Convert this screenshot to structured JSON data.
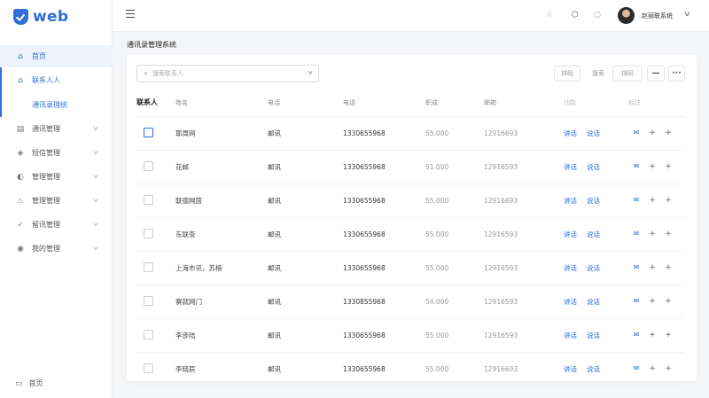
{
  "brand": {
    "name": "web"
  },
  "colors": {
    "accent": "#2f6fd6"
  },
  "sidebar": {
    "items": [
      {
        "label": "首页",
        "icon": "home-icon",
        "state": "highlight"
      },
      {
        "label": "联系人人",
        "icon": "home-icon",
        "state": "active"
      },
      {
        "label": "通讯录理统",
        "icon": "",
        "state": "sub"
      },
      {
        "label": "通讯管理",
        "icon": "document-icon",
        "state": "collapsed"
      },
      {
        "label": "短信管理",
        "icon": "leaf-icon",
        "state": "collapsed"
      },
      {
        "label": "管理管理",
        "icon": "headset-icon",
        "state": "collapsed"
      },
      {
        "label": "管理管理",
        "icon": "cake-icon",
        "state": "collapsed"
      },
      {
        "label": "留讯管理",
        "icon": "check-shield-icon",
        "state": "collapsed"
      },
      {
        "label": "我的管理",
        "icon": "location-icon",
        "state": "collapsed"
      }
    ],
    "footer_label": "首页"
  },
  "topbar": {
    "icons": [
      "bell-icon",
      "settings-icon",
      "message-icon"
    ],
    "user_name": "赵丽联系统"
  },
  "page": {
    "title": "通讯录管理系统"
  },
  "toolbar": {
    "search_placeholder": "搜索联系人",
    "btn1": "排码",
    "btn2": "搜索",
    "btn3": "排码",
    "btn4": "—",
    "btn5": "···"
  },
  "table": {
    "headers": [
      "联系人",
      "姓名",
      "电话",
      "电话",
      "职成",
      "邮箱",
      "功能",
      "标注"
    ],
    "row_actions": {
      "a": "讲话",
      "b": "说话"
    },
    "rows": [
      {
        "name": "耶周网",
        "tag": "邮讯",
        "phone": "1330655968",
        "amount": "55.000",
        "code": "12916693",
        "checked": true
      },
      {
        "name": "花邮",
        "tag": "邮讯",
        "phone": "1330655968",
        "amount": "51.000",
        "code": "12916593",
        "checked": false
      },
      {
        "name": "联德网茵",
        "tag": "邮讯",
        "phone": "1330655968",
        "amount": "55.000",
        "code": "12916693",
        "checked": false
      },
      {
        "name": "东联查",
        "tag": "邮讯",
        "phone": "1330655968",
        "amount": "55.000",
        "code": "12916593",
        "checked": false
      },
      {
        "name": "上海市讯，苏榕",
        "tag": "邮讯",
        "phone": "1330655968",
        "amount": "55.000",
        "code": "12916593",
        "checked": false
      },
      {
        "name": "赛就网门",
        "tag": "邮讯",
        "phone": "1330855968",
        "amount": "54.000",
        "code": "12916593",
        "checked": false
      },
      {
        "name": "李彦陆",
        "tag": "邮讯",
        "phone": "1330655968",
        "amount": "55.000",
        "code": "12916593",
        "checked": false
      },
      {
        "name": "李晓辰",
        "tag": "邮讯",
        "phone": "1330655968",
        "amount": "55.000",
        "code": "12916693",
        "checked": false
      }
    ]
  }
}
